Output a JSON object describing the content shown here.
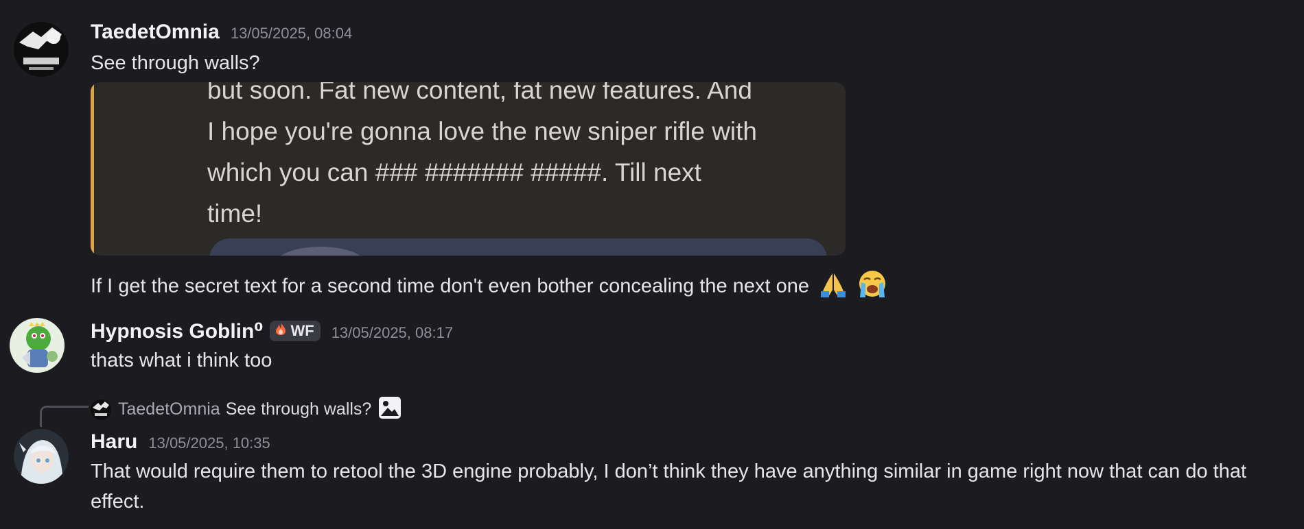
{
  "messages": [
    {
      "author": "TaedetOmnia",
      "timestamp": "13/05/2025, 08:04",
      "text": "See through walls?",
      "embed": {
        "lines": [
          "but soon. Fat new content, fat new features. And",
          "I hope you're gonna love the new sniper rifle with",
          "which you can ### ####### #####. Till next",
          "time!"
        ],
        "accent_color": "#d9a441"
      },
      "followup_text": "If I get the secret text for a second time don't even bother concealing the next one",
      "followup_emojis": [
        "folded-hands-emoji",
        "loudly-crying-emoji"
      ]
    },
    {
      "author": "Hypnosis Goblin⁰",
      "badge": "WF",
      "timestamp": "13/05/2025, 08:17",
      "text": "thats what i think too"
    },
    {
      "reply_to": {
        "author": "TaedetOmnia",
        "text": "See through walls?",
        "attachment_icon": "image-icon"
      },
      "author": "Haru",
      "timestamp": "13/05/2025, 10:35",
      "text": "That would require them to retool the 3D engine probably, I don’t think they have anything similar in game right now that can do that effect."
    }
  ],
  "colors": {
    "background": "#1b1b20",
    "timestamp": "#8e9099",
    "embed_background": "#2b2a28"
  }
}
